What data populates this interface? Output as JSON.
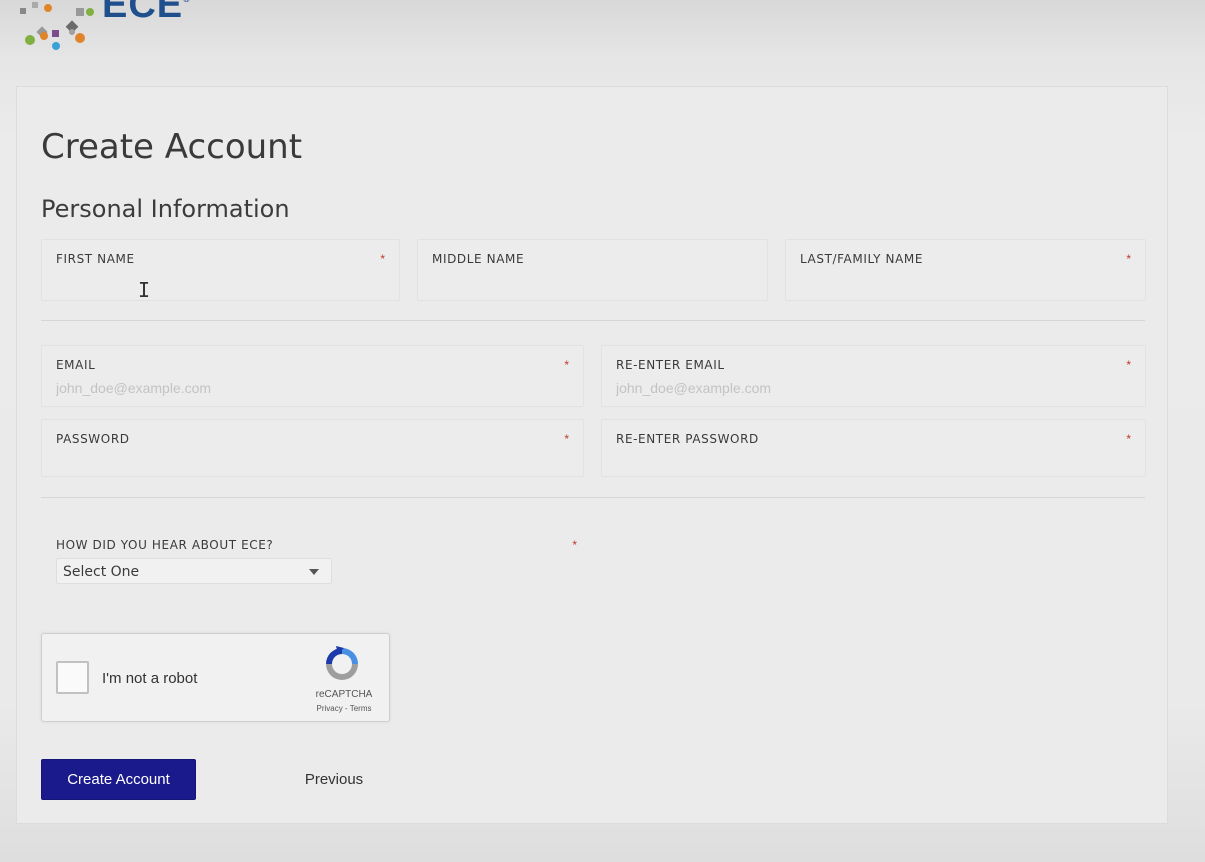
{
  "brand": {
    "logo_text": "ECE",
    "logo_mark": "®"
  },
  "page": {
    "title": "Create Account",
    "section_title": "Personal Information"
  },
  "fields": {
    "first_name": {
      "label": "FIRST NAME",
      "required": "*",
      "value": "",
      "placeholder": ""
    },
    "middle_name": {
      "label": "MIDDLE NAME",
      "value": "",
      "placeholder": ""
    },
    "last_name": {
      "label": "LAST/FAMILY NAME",
      "required": "*",
      "value": "",
      "placeholder": ""
    },
    "email": {
      "label": "EMAIL",
      "required": "*",
      "value": "",
      "placeholder": "john_doe@example.com"
    },
    "email_confirm": {
      "label": "RE-ENTER EMAIL",
      "required": "*",
      "value": "",
      "placeholder": "john_doe@example.com"
    },
    "password": {
      "label": "PASSWORD",
      "required": "*",
      "value": ""
    },
    "password_confirm": {
      "label": "RE-ENTER PASSWORD",
      "required": "*",
      "value": ""
    },
    "referral": {
      "label": "HOW DID YOU HEAR ABOUT ECE?",
      "required": "*",
      "selected": "Select One"
    }
  },
  "recaptcha": {
    "label": "I'm not a robot",
    "brand": "reCAPTCHA",
    "links": "Privacy - Terms"
  },
  "actions": {
    "create_label": "Create Account",
    "previous_label": "Previous"
  },
  "colors": {
    "primary_button": "#1a1a8c",
    "required_marker": "#c0392b",
    "logo_text": "#1f4f8c"
  }
}
